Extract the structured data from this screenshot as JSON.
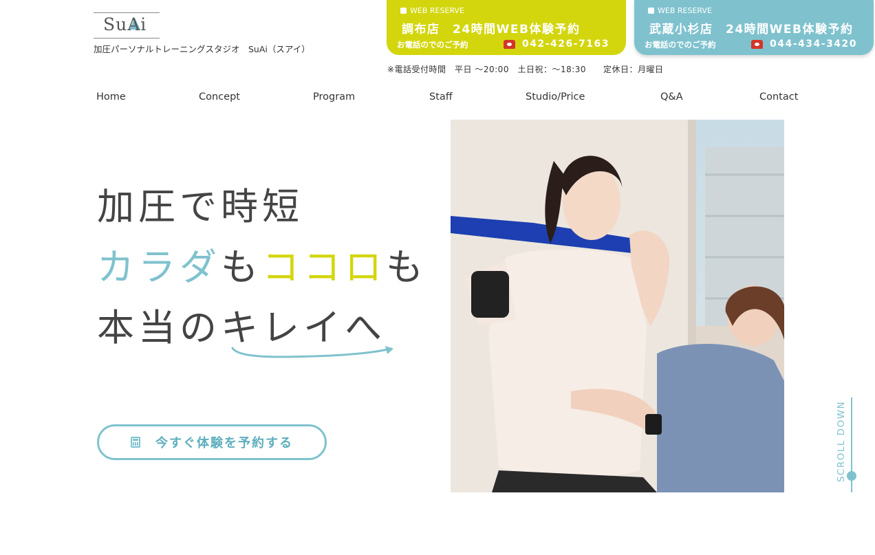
{
  "header": {
    "logo_text": "SuAi",
    "tagline": "加圧パーソナルトレーニングスタジオ　SuAi（スアイ）"
  },
  "reserve": [
    {
      "badge": "WEB RESERVE",
      "title": "調布店　24時間WEB体験予約",
      "phone_label": "お電話のでのご予約",
      "phone": "042-426-7163",
      "color": "#d3d60c"
    },
    {
      "badge": "WEB RESERVE",
      "title": "武蔵小杉店　24時間WEB体験予約",
      "phone_label": "お電話のでのご予約",
      "phone": "044-434-3420",
      "color": "#7fc2ce"
    }
  ],
  "hours": "※電話受付時間　平日 ～20:00　土日祝：～18:30　　定休日：月曜日",
  "nav": [
    "Home",
    "Concept",
    "Program",
    "Staff",
    "Studio/Price",
    "Q&A",
    "Contact"
  ],
  "hero": {
    "line1": "加圧で時短",
    "line2_a": "カラダ",
    "line2_b": "も",
    "line2_c": "ココロ",
    "line2_d": "も",
    "line3": "本当のキレイへ"
  },
  "cta": {
    "label": "今すぐ体験を予約する",
    "icon": "calculator-icon"
  },
  "scroll": "SCROLL DOWN",
  "colors": {
    "accent_yellow": "#d3d60c",
    "accent_blue": "#7fc2ce",
    "text": "#444444"
  }
}
